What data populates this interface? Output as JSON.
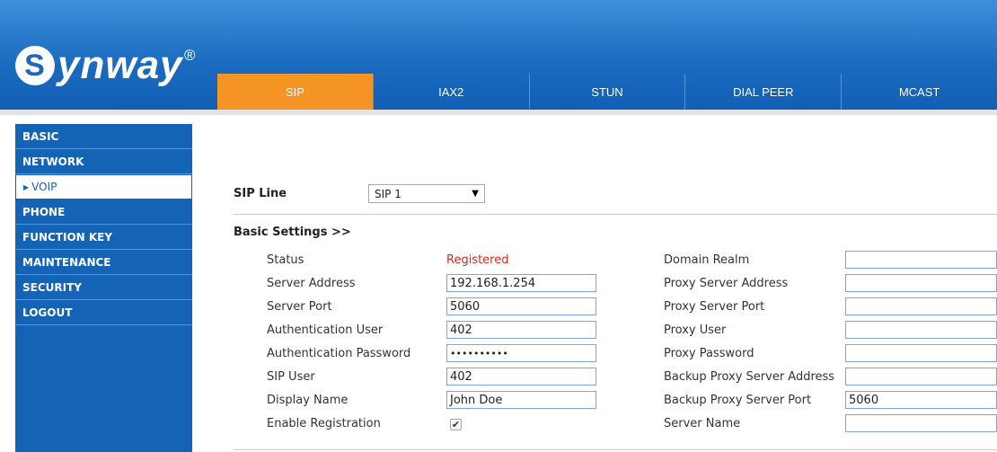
{
  "brand": {
    "name": "ynway",
    "mark": "S",
    "reg": "®"
  },
  "tabs": [
    "SIP",
    "IAX2",
    "STUN",
    "DIAL PEER",
    "MCAST"
  ],
  "sidebar": [
    "BASIC",
    "NETWORK",
    "VOIP",
    "PHONE",
    "FUNCTION KEY",
    "MAINTENANCE",
    "SECURITY",
    "LOGOUT"
  ],
  "sip_line": {
    "label": "SIP Line",
    "selected": "SIP 1"
  },
  "basic_settings_label": "Basic Settings >>",
  "left_fields": {
    "status": {
      "label": "Status",
      "value": "Registered"
    },
    "server_address": {
      "label": "Server Address",
      "value": "192.168.1.254"
    },
    "server_port": {
      "label": "Server Port",
      "value": "5060"
    },
    "auth_user": {
      "label": "Authentication User",
      "value": "402"
    },
    "auth_password": {
      "label": "Authentication Password",
      "value": "••••••••••"
    },
    "sip_user": {
      "label": "SIP User",
      "value": "402"
    },
    "display_name": {
      "label": "Display Name",
      "value": "John Doe"
    },
    "enable_registration": {
      "label": "Enable Registration",
      "checked": "✔"
    }
  },
  "right_fields": {
    "domain_realm": {
      "label": "Domain Realm",
      "value": ""
    },
    "proxy_server_address": {
      "label": "Proxy Server Address",
      "value": ""
    },
    "proxy_server_port": {
      "label": "Proxy Server Port",
      "value": ""
    },
    "proxy_user": {
      "label": "Proxy User",
      "value": ""
    },
    "proxy_password": {
      "label": "Proxy Password",
      "value": ""
    },
    "backup_proxy_server_address": {
      "label": "Backup Proxy Server Address",
      "value": ""
    },
    "backup_proxy_server_port": {
      "label": "Backup Proxy Server Port",
      "value": "5060"
    },
    "server_name": {
      "label": "Server Name",
      "value": ""
    }
  },
  "colors": {
    "header_blue": "#1a6ac0",
    "active_tab": "#f39425",
    "sidebar_blue": "#1563b5",
    "status_red": "#d42a1e"
  }
}
